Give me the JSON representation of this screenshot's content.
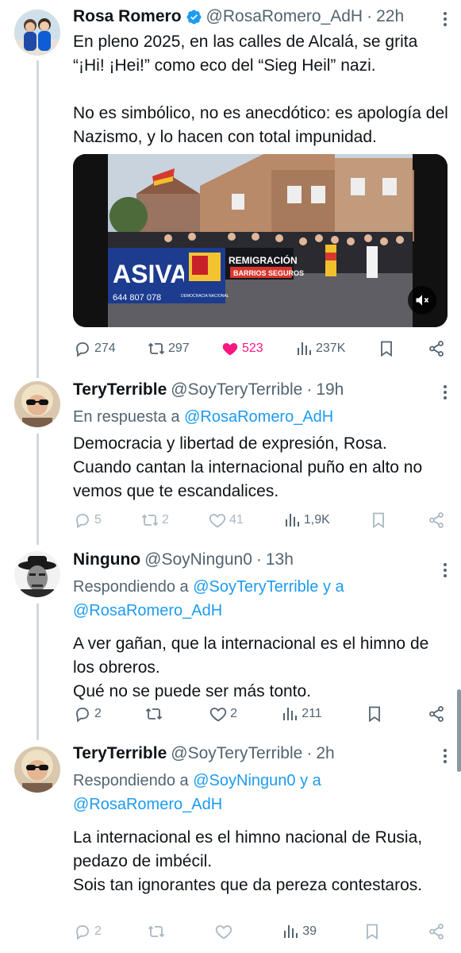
{
  "tweets": [
    {
      "name": "Rosa Romero",
      "verified": true,
      "handle": "@RosaRomero_AdH",
      "time": "22h",
      "text": "En pleno 2025, en las calles de Alcalá, se grita “¡Hi! ¡Hei!” como eco del “Sieg Heil” nazi.\n\nNo es simbólico, no es anecdótico: es apología del Nazismo, y lo hacen con total impunidad.",
      "media": {
        "banner_left": "ASIVAS",
        "banner_phone": "644 807 078",
        "banner_party": "DEMOCRACIA NACIONAL",
        "banner_right_1": "REMIGRACIÓN",
        "banner_right_2": "BARRIOS SEGUROS"
      },
      "stats": {
        "replies": "274",
        "reposts": "297",
        "likes": "523",
        "views": "237K"
      }
    },
    {
      "name": "TeryTerrible",
      "handle": "@SoyTeryTerrible",
      "time": "19h",
      "reply_prefix": "En respuesta a",
      "reply_to_1": "@RosaRomero_AdH",
      "text": "Democracia y libertad de expresión, Rosa. Cuando cantan la internacional puño en alto no vemos que te escandalices.",
      "stats": {
        "replies": "5",
        "reposts": "2",
        "likes": "41",
        "views": "1,9K"
      }
    },
    {
      "name": "Ninguno",
      "handle": "@SoyNingun0",
      "time": "13h",
      "reply_prefix": "Respondiendo a",
      "reply_to_1": "@SoyTeryTerrible",
      "reply_join": "y a",
      "reply_to_2": "@RosaRomero_AdH",
      "text": "A ver gañan, que la internacional es el himno de los obreros.\nQué no se puede ser más tonto.",
      "stats": {
        "replies": "2",
        "reposts": "",
        "likes": "2",
        "views": "211"
      }
    },
    {
      "name": "TeryTerrible",
      "handle": "@SoyTeryTerrible",
      "time": "2h",
      "reply_prefix": "Respondiendo a",
      "reply_to_1": "@SoyNingun0",
      "reply_join": "y a",
      "reply_to_2": "@RosaRomero_AdH",
      "text": "La internacional es el himno nacional de Rusia, pedazo de imbécil.\nSois tan ignorantes que da pereza contestaros.",
      "stats": {
        "replies": "2",
        "reposts": "",
        "likes": "",
        "views": "39"
      }
    }
  ],
  "colors": {
    "link": "#1d9bf0",
    "like": "#f91880",
    "muted": "#536471",
    "verified": "#1d9bf0"
  },
  "icons": [
    "verified-badge-icon",
    "more-icon",
    "reply-icon",
    "repost-icon",
    "like-icon",
    "views-icon",
    "bookmark-icon",
    "share-icon",
    "mute-icon"
  ]
}
